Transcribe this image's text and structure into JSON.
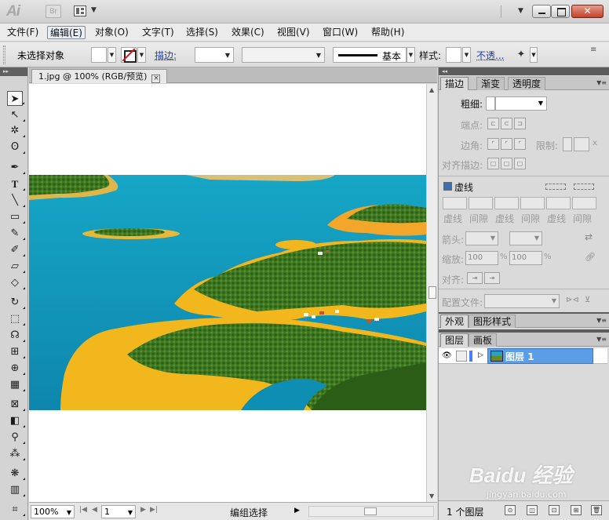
{
  "titlebar": {
    "app_logo": "Ai",
    "bridge_label": "Br"
  },
  "menu": {
    "items": [
      "文件(F)",
      "编辑(E)",
      "对象(O)",
      "文字(T)",
      "选择(S)",
      "效果(C)",
      "视图(V)",
      "窗口(W)",
      "帮助(H)"
    ],
    "active": "编辑(E)"
  },
  "controlbar": {
    "selection_label": "未选择对象",
    "stroke_label": "描边:",
    "brush_label": "基本",
    "style_label": "样式:",
    "opacity_label": "不透..."
  },
  "document": {
    "tab_title": "1.jpg @ 100% (RGB/预览)",
    "tab_close": "×",
    "image_description": "aerial lake landscape with green islands and yellow shores"
  },
  "statusbar": {
    "zoom": "100%",
    "page": "1",
    "status_text": "编组选择"
  },
  "panel_top": {
    "tabs": [
      "描边",
      "渐变",
      "透明度"
    ],
    "active_tab": "描边",
    "weight_label": "粗细:",
    "cap_label": "端点:",
    "corner_label": "边角:",
    "limit_label": "限制:",
    "limit_unit": "x",
    "align_label": "对齐描边:",
    "dashed_label": "虚线",
    "dash_labels": [
      "虚线",
      "间隙",
      "虚线",
      "间隙",
      "虚线",
      "间隙"
    ],
    "arrow_label": "箭头:",
    "scale_label": "缩放:",
    "scale_value_1": "100",
    "scale_value_2": "100",
    "percent": "%",
    "align2_label": "对齐:",
    "profile_label": "配置文件:"
  },
  "panel_mid": {
    "tabs": [
      "外观",
      "图形样式"
    ],
    "active_tab": "外观"
  },
  "panel_layers": {
    "tabs": [
      "图层",
      "画板"
    ],
    "active_tab": "图层",
    "layer_name": "图层 1",
    "count_label": "1 个图层"
  },
  "watermark": {
    "text": "Baidu 经验",
    "sub": "jingyan.baidu.com"
  },
  "colors": {
    "selection_blue": "#5c9ee6",
    "close_red": "#c5422a",
    "lake_blue": "#12a2c4",
    "island_green": "#3f7a23",
    "shore_yellow": "#f2b71c"
  }
}
